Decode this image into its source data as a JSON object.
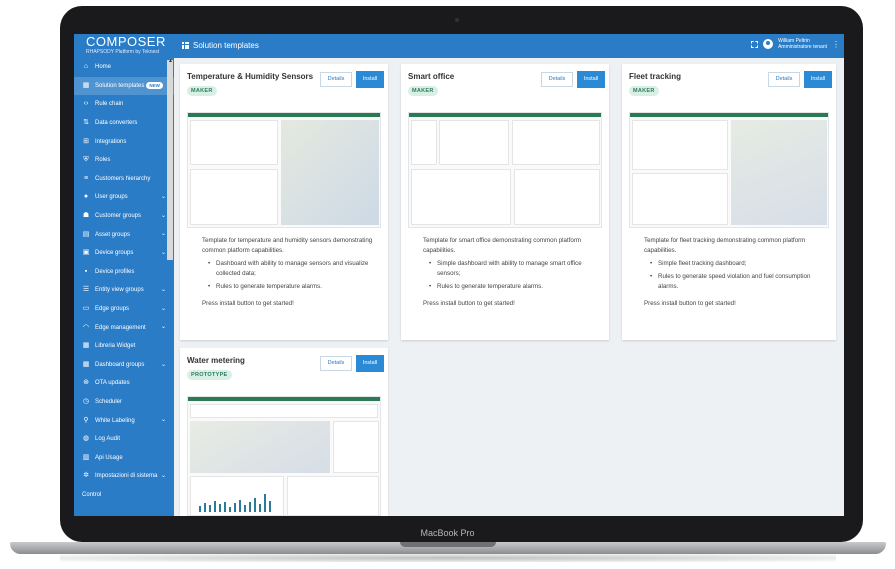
{
  "device": {
    "label": "MacBook Pro"
  },
  "topbar": {
    "brand_name": "COMPOSER",
    "brand_sub": "RHAPSODY Platform by Teknest",
    "page_title": "Solution templates",
    "user_name": "William Peltrin",
    "user_role": "Amministratore tenant"
  },
  "sidebar": {
    "items": [
      {
        "label": "Home",
        "icon": "home-icon"
      },
      {
        "label": "Solution templates",
        "icon": "grid-icon",
        "badge": "NEW",
        "active": true
      },
      {
        "label": "Rule chain",
        "icon": "code-icon"
      },
      {
        "label": "Data converters",
        "icon": "converter-icon"
      },
      {
        "label": "Integrations",
        "icon": "integration-icon"
      },
      {
        "label": "Roles",
        "icon": "shield-icon"
      },
      {
        "label": "Customers hierarchy",
        "icon": "hierarchy-icon"
      },
      {
        "label": "User groups",
        "icon": "user-icon",
        "chevron": true
      },
      {
        "label": "Customer groups",
        "icon": "customers-icon",
        "chevron": true
      },
      {
        "label": "Asset groups",
        "icon": "asset-icon",
        "chevron": true
      },
      {
        "label": "Device groups",
        "icon": "device-icon",
        "chevron": true
      },
      {
        "label": "Device profiles",
        "icon": "profile-icon"
      },
      {
        "label": "Entity view groups",
        "icon": "entity-icon",
        "chevron": true
      },
      {
        "label": "Edge groups",
        "icon": "edge-icon",
        "chevron": true
      },
      {
        "label": "Edge management",
        "icon": "wifi-icon",
        "chevron": true
      },
      {
        "label": "Libreria Widget",
        "icon": "widget-icon"
      },
      {
        "label": "Dashboard groups",
        "icon": "dashboard-icon",
        "chevron": true
      },
      {
        "label": "OTA updates",
        "icon": "ota-icon"
      },
      {
        "label": "Scheduler",
        "icon": "clock-icon"
      },
      {
        "label": "White Labeling",
        "icon": "brush-icon",
        "chevron": true
      },
      {
        "label": "Log Audit",
        "icon": "log-icon"
      },
      {
        "label": "Api Usage",
        "icon": "api-icon"
      },
      {
        "label": "Impostazioni di sistema",
        "icon": "gear-icon",
        "chevron": true
      },
      {
        "label": "Control",
        "icon": ""
      }
    ]
  },
  "cards": [
    {
      "title": "Temperature & Humidity Sensors",
      "tag": "MAKER",
      "details": "Details",
      "install": "Install",
      "intro": "Template for temperature and humidity sensors demonstrating common platform capabilities.",
      "bullets": [
        "Dashboard with ability to manage sensors and visualize collected data;",
        "Rules to generate temperature alarms."
      ],
      "cta": "Press install button to get started!"
    },
    {
      "title": "Smart office",
      "tag": "MAKER",
      "details": "Details",
      "install": "Install",
      "intro": "Template for smart office demonstrating common platform capabilities.",
      "bullets": [
        "Simple dashboard with ability to manage smart office sensors;",
        "Rules to generate temperature alarms."
      ],
      "cta": "Press install button to get started!"
    },
    {
      "title": "Fleet tracking",
      "tag": "MAKER",
      "details": "Details",
      "install": "Install",
      "intro": "Template for fleet tracking demonstrating common platform capabilities.",
      "bullets": [
        "Simple fleet tracking dashboard;",
        "Rules to generate speed violation and fuel consumption alarms."
      ],
      "cta": "Press install button to get started!"
    },
    {
      "title": "Water metering",
      "tag": "PROTOTYPE",
      "details": "Details",
      "install": "Install"
    }
  ],
  "colors": {
    "primary": "#2a7cc7",
    "install": "#2a8ad6",
    "tag_bg": "#d8efe6",
    "tag_text": "#2e7d5b"
  }
}
